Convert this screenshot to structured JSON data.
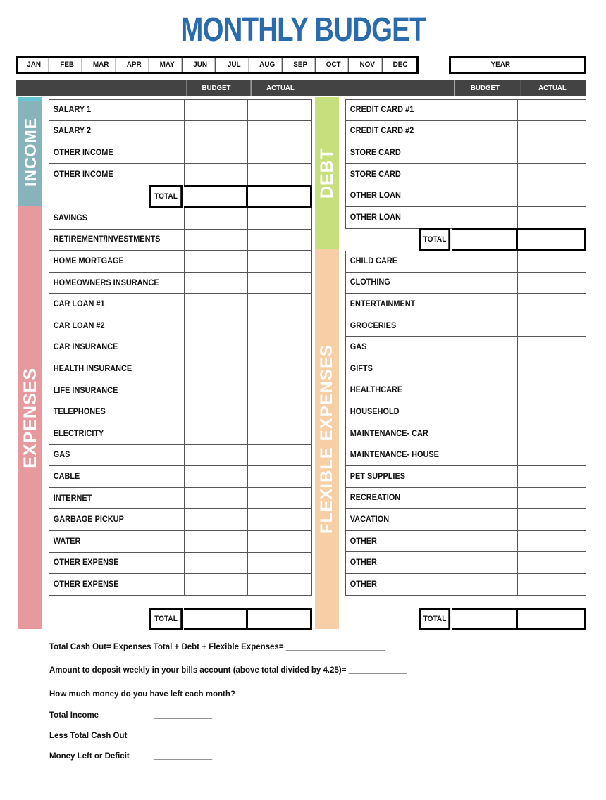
{
  "title": "MONTHLY BUDGET",
  "months": [
    "JAN",
    "FEB",
    "MAR",
    "APR",
    "MAY",
    "JUN",
    "JUL",
    "AUG",
    "SEP",
    "OCT",
    "NOV",
    "DEC"
  ],
  "year_label": "YEAR",
  "year_value": "",
  "column_headers": {
    "budget": "BUDGET",
    "actual": "ACTUAL"
  },
  "total_label": "TOTAL",
  "colors": {
    "title": "#2a6bad",
    "header_bar": "#434343",
    "income_band": "#87b3bb",
    "income_band_cap": "#68c6d4",
    "expenses_band": "#e79a9d",
    "debt_band": "#c6e07e",
    "flexible_band": "#f7cfa6"
  },
  "sections": {
    "income": {
      "band_label": "INCOME",
      "rows": [
        {
          "label": "SALARY  1",
          "budget": "",
          "actual": ""
        },
        {
          "label": "SALARY  2",
          "budget": "",
          "actual": ""
        },
        {
          "label": "OTHER INCOME",
          "budget": "",
          "actual": ""
        },
        {
          "label": "OTHER INCOME",
          "budget": "",
          "actual": ""
        }
      ],
      "total": {
        "label": "TOTAL",
        "budget": "",
        "actual": ""
      }
    },
    "expenses": {
      "band_label": "EXPENSES",
      "rows": [
        {
          "label": "SAVINGS",
          "budget": "",
          "actual": ""
        },
        {
          "label": "RETIREMENT/INVESTMENTS",
          "budget": "",
          "actual": ""
        },
        {
          "label": "HOME MORTGAGE",
          "budget": "",
          "actual": ""
        },
        {
          "label": "HOMEOWNERS INSURANCE",
          "budget": "",
          "actual": ""
        },
        {
          "label": "CAR LOAN #1",
          "budget": "",
          "actual": ""
        },
        {
          "label": "CAR LOAN #2",
          "budget": "",
          "actual": ""
        },
        {
          "label": "CAR INSURANCE",
          "budget": "",
          "actual": ""
        },
        {
          "label": "HEALTH INSURANCE",
          "budget": "",
          "actual": ""
        },
        {
          "label": "LIFE INSURANCE",
          "budget": "",
          "actual": ""
        },
        {
          "label": "TELEPHONES",
          "budget": "",
          "actual": ""
        },
        {
          "label": "ELECTRICITY",
          "budget": "",
          "actual": ""
        },
        {
          "label": "GAS",
          "budget": "",
          "actual": ""
        },
        {
          "label": "CABLE",
          "budget": "",
          "actual": ""
        },
        {
          "label": "INTERNET",
          "budget": "",
          "actual": ""
        },
        {
          "label": "GARBAGE PICKUP",
          "budget": "",
          "actual": ""
        },
        {
          "label": "WATER",
          "budget": "",
          "actual": ""
        },
        {
          "label": "OTHER EXPENSE",
          "budget": "",
          "actual": ""
        },
        {
          "label": "OTHER EXPENSE",
          "budget": "",
          "actual": ""
        }
      ],
      "total": {
        "label": "TOTAL",
        "budget": "",
        "actual": ""
      }
    },
    "debt": {
      "band_label": "DEBT",
      "rows": [
        {
          "label": "CREDIT CARD #1",
          "budget": "",
          "actual": ""
        },
        {
          "label": "CREDIT CARD #2",
          "budget": "",
          "actual": ""
        },
        {
          "label": "STORE CARD",
          "budget": "",
          "actual": ""
        },
        {
          "label": "STORE CARD",
          "budget": "",
          "actual": ""
        },
        {
          "label": "OTHER LOAN",
          "budget": "",
          "actual": ""
        },
        {
          "label": "OTHER LOAN",
          "budget": "",
          "actual": ""
        }
      ],
      "total": {
        "label": "TOTAL",
        "budget": "",
        "actual": ""
      }
    },
    "flexible": {
      "band_label": "FLEXIBLE EXPENSES",
      "rows": [
        {
          "label": "CHILD CARE",
          "budget": "",
          "actual": ""
        },
        {
          "label": "CLOTHING",
          "budget": "",
          "actual": ""
        },
        {
          "label": "ENTERTAINMENT",
          "budget": "",
          "actual": ""
        },
        {
          "label": "GROCERIES",
          "budget": "",
          "actual": ""
        },
        {
          "label": "GAS",
          "budget": "",
          "actual": ""
        },
        {
          "label": "GIFTS",
          "budget": "",
          "actual": ""
        },
        {
          "label": "HEALTHCARE",
          "budget": "",
          "actual": ""
        },
        {
          "label": "HOUSEHOLD",
          "budget": "",
          "actual": ""
        },
        {
          "label": "MAINTENANCE- CAR",
          "budget": "",
          "actual": ""
        },
        {
          "label": "MAINTENANCE- HOUSE",
          "budget": "",
          "actual": ""
        },
        {
          "label": "PET SUPPLIES",
          "budget": "",
          "actual": ""
        },
        {
          "label": "RECREATION",
          "budget": "",
          "actual": ""
        },
        {
          "label": "VACATION",
          "budget": "",
          "actual": ""
        },
        {
          "label": "OTHER",
          "budget": "",
          "actual": ""
        },
        {
          "label": "OTHER",
          "budget": "",
          "actual": ""
        },
        {
          "label": "OTHER",
          "budget": "",
          "actual": ""
        }
      ],
      "total": {
        "label": "TOTAL",
        "budget": "",
        "actual": ""
      }
    }
  },
  "footer": {
    "line1": "Total Cash Out= Expenses Total + Debt + Flexible Expenses= ______________________",
    "line2": "Amount to deposit weekly in your bills account (above total divided by 4.25)= _____________",
    "question": "How much money do you have left each month?",
    "rows": [
      {
        "label": "Total Income",
        "blank": "_____________"
      },
      {
        "label": "Less Total Cash Out",
        "blank": "_____________"
      },
      {
        "label": "Money Left or Deficit",
        "blank": "_____________"
      }
    ]
  }
}
